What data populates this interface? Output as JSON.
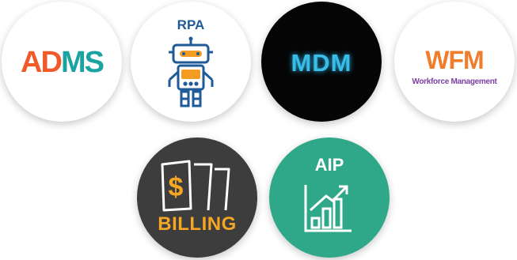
{
  "badges": {
    "adms": {
      "part1": "AD",
      "part2": "MS"
    },
    "rpa": {
      "label": "RPA"
    },
    "mdm": {
      "label": "MDM"
    },
    "wfm": {
      "label": "WFM",
      "sub": "Workforce Management"
    },
    "billing": {
      "label": "BILLING",
      "symbol": "$"
    },
    "aip": {
      "label": "AIP"
    }
  },
  "icons": {
    "rpa": "robot-icon",
    "billing": "bills-icon",
    "aip": "growth-chart-icon"
  },
  "colors": {
    "adms_orange": "#f05a28",
    "adms_teal": "#1aa3a0",
    "rpa_blue": "#1e5b98",
    "rpa_orange": "#f39c21",
    "mdm_glow": "#39bde6",
    "wfm_orange": "#ef7d2c",
    "wfm_purple": "#7b3fa0",
    "billing_bg": "#3d3d3d",
    "billing_orange": "#f5a623",
    "aip_green": "#2fa88a"
  }
}
